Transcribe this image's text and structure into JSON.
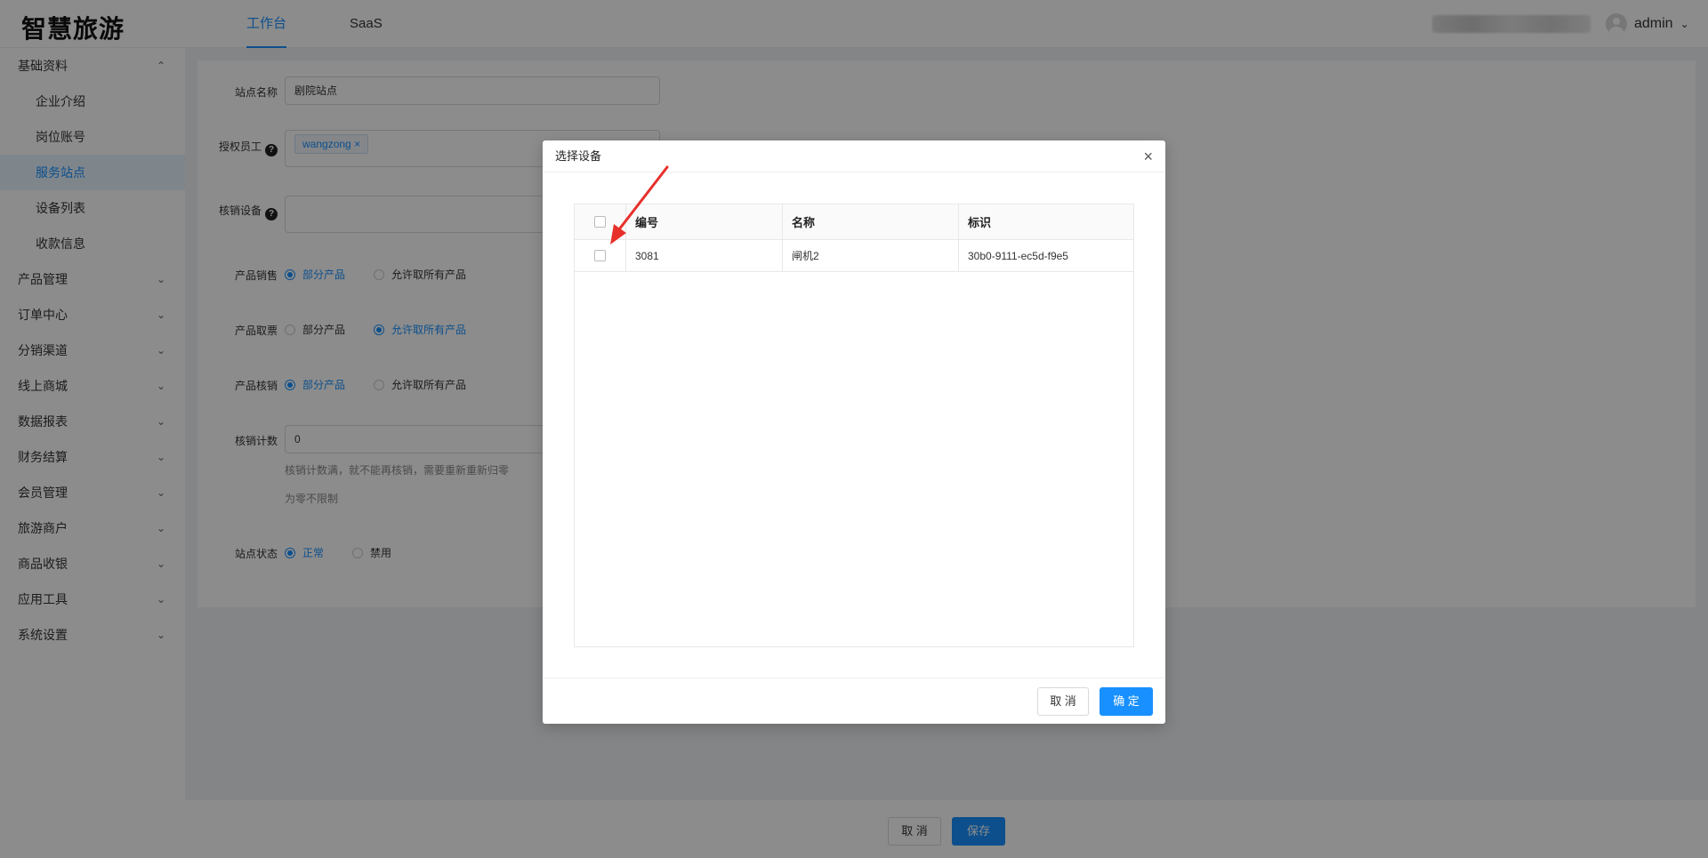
{
  "header": {
    "logo": "智慧旅游",
    "tabs": [
      {
        "label": "工作台"
      },
      {
        "label": "SaaS"
      }
    ],
    "user": "admin"
  },
  "sidebar": {
    "items": [
      {
        "label": "基础资料"
      },
      {
        "label": "企业介绍"
      },
      {
        "label": "岗位账号"
      },
      {
        "label": "服务站点"
      },
      {
        "label": "设备列表"
      },
      {
        "label": "收款信息"
      },
      {
        "label": "产品管理"
      },
      {
        "label": "订单中心"
      },
      {
        "label": "分销渠道"
      },
      {
        "label": "线上商城"
      },
      {
        "label": "数据报表"
      },
      {
        "label": "财务结算"
      },
      {
        "label": "会员管理"
      },
      {
        "label": "旅游商户"
      },
      {
        "label": "商品收银"
      },
      {
        "label": "应用工具"
      },
      {
        "label": "系统设置"
      }
    ]
  },
  "form": {
    "station_name_label": "站点名称",
    "station_name_value": "剧院站点",
    "staff_label": "授权员工",
    "staff_tag": "wangzong",
    "device_label": "核销设备",
    "sale_label": "产品销售",
    "pickup_label": "产品取票",
    "verify_label": "产品核销",
    "opt_partial": "部分产品",
    "opt_all": "允许取所有产品",
    "count_label": "核销计数",
    "count_value": "0",
    "count_hint1": "核销计数满，就不能再核销，需要重新重新归零",
    "count_hint2": "为零不限制",
    "status_label": "站点状态",
    "status_normal": "正常",
    "status_disabled": "禁用"
  },
  "bottom": {
    "cancel": "取 消",
    "save": "保存"
  },
  "modal": {
    "title": "选择设备",
    "columns": [
      "编号",
      "名称",
      "标识"
    ],
    "rows": [
      {
        "id": "3081",
        "name": "闸机2",
        "mark": "30b0-9111-ec5d-f9e5"
      }
    ],
    "cancel": "取 消",
    "ok": "确 定"
  }
}
